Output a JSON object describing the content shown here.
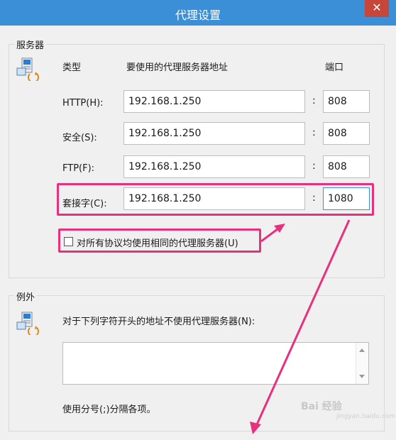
{
  "window": {
    "title": "代理设置",
    "close": "✕"
  },
  "servers": {
    "group_label": "服务器",
    "header_type": "类型",
    "header_address": "要使用的代理服务器地址",
    "header_port": "端口",
    "rows": [
      {
        "label": "HTTP(H):",
        "address": "192.168.1.250",
        "port": "808"
      },
      {
        "label": "安全(S):",
        "address": "192.168.1.250",
        "port": "808"
      },
      {
        "label": "FTP(F):",
        "address": "192.168.1.250",
        "port": "808"
      },
      {
        "label": "套接字(C):",
        "address": "192.168.1.250",
        "port": "1080"
      }
    ],
    "colon": ":",
    "same_proxy_label": "对所有协议均使用相同的代理服务器(U)",
    "same_proxy_checked": false
  },
  "exceptions": {
    "group_label": "例外",
    "description": "对于下列字符开头的地址不使用代理服务器(N):",
    "value": "",
    "hint": "使用分号(;)分隔各项。"
  },
  "watermark": {
    "text": "Bai 经验",
    "sub": "jingyan.baidu.com"
  },
  "annotation_color": "#e8307d",
  "icons": [
    "network-computer-icon",
    "close-icon",
    "scroll-up-arrow-icon",
    "scroll-down-arrow-icon"
  ]
}
